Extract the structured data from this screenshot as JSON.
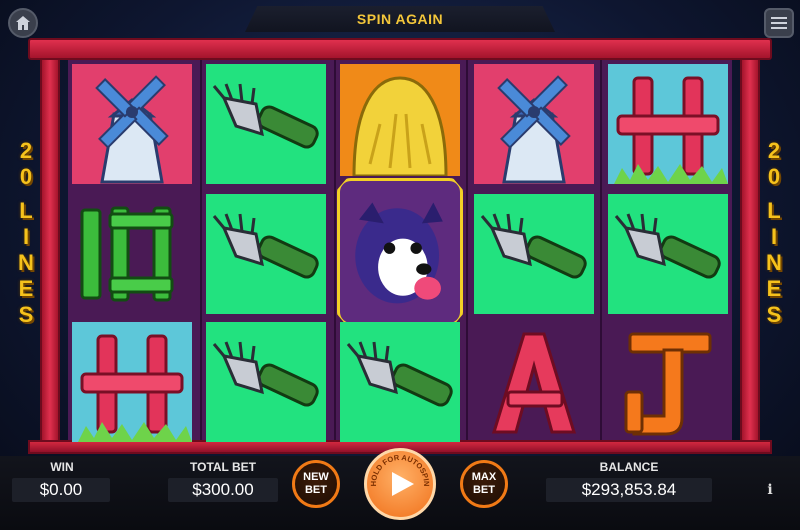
{
  "header": {
    "title": "SPIN AGAIN",
    "home_icon": "home-icon",
    "menu_icon": "menu-icon"
  },
  "side": {
    "left_lines": [
      "2",
      "0",
      "L",
      "I",
      "N",
      "E",
      "S"
    ],
    "right_lines": [
      "2",
      "0",
      "L",
      "I",
      "N",
      "E",
      "S"
    ]
  },
  "reels": [
    [
      "windmill",
      "sign-10",
      "fence-h"
    ],
    [
      "pitchfork",
      "pitchfork",
      "pitchfork"
    ],
    [
      "haystack",
      "dog-wild",
      "pitchfork"
    ],
    [
      "windmill",
      "pitchfork",
      "letter-a"
    ],
    [
      "fence-h",
      "pitchfork",
      "letter-j"
    ]
  ],
  "footer": {
    "win_label": "WIN",
    "win_value": "$0.00",
    "total_bet_label": "TOTAL BET",
    "total_bet_value": "$300.00",
    "new_bet_label_1": "NEW",
    "new_bet_label_2": "BET",
    "spin_hint": "HOLD FOR AUTOSPIN",
    "max_bet_label_1": "MAX",
    "max_bet_label_2": "BET",
    "balance_label": "BALANCE",
    "balance_value": "$293,853.84",
    "info_label": "i"
  },
  "colors": {
    "accent": "#f6c21c",
    "frame": "#d2283f",
    "button_border": "#f07a16"
  }
}
